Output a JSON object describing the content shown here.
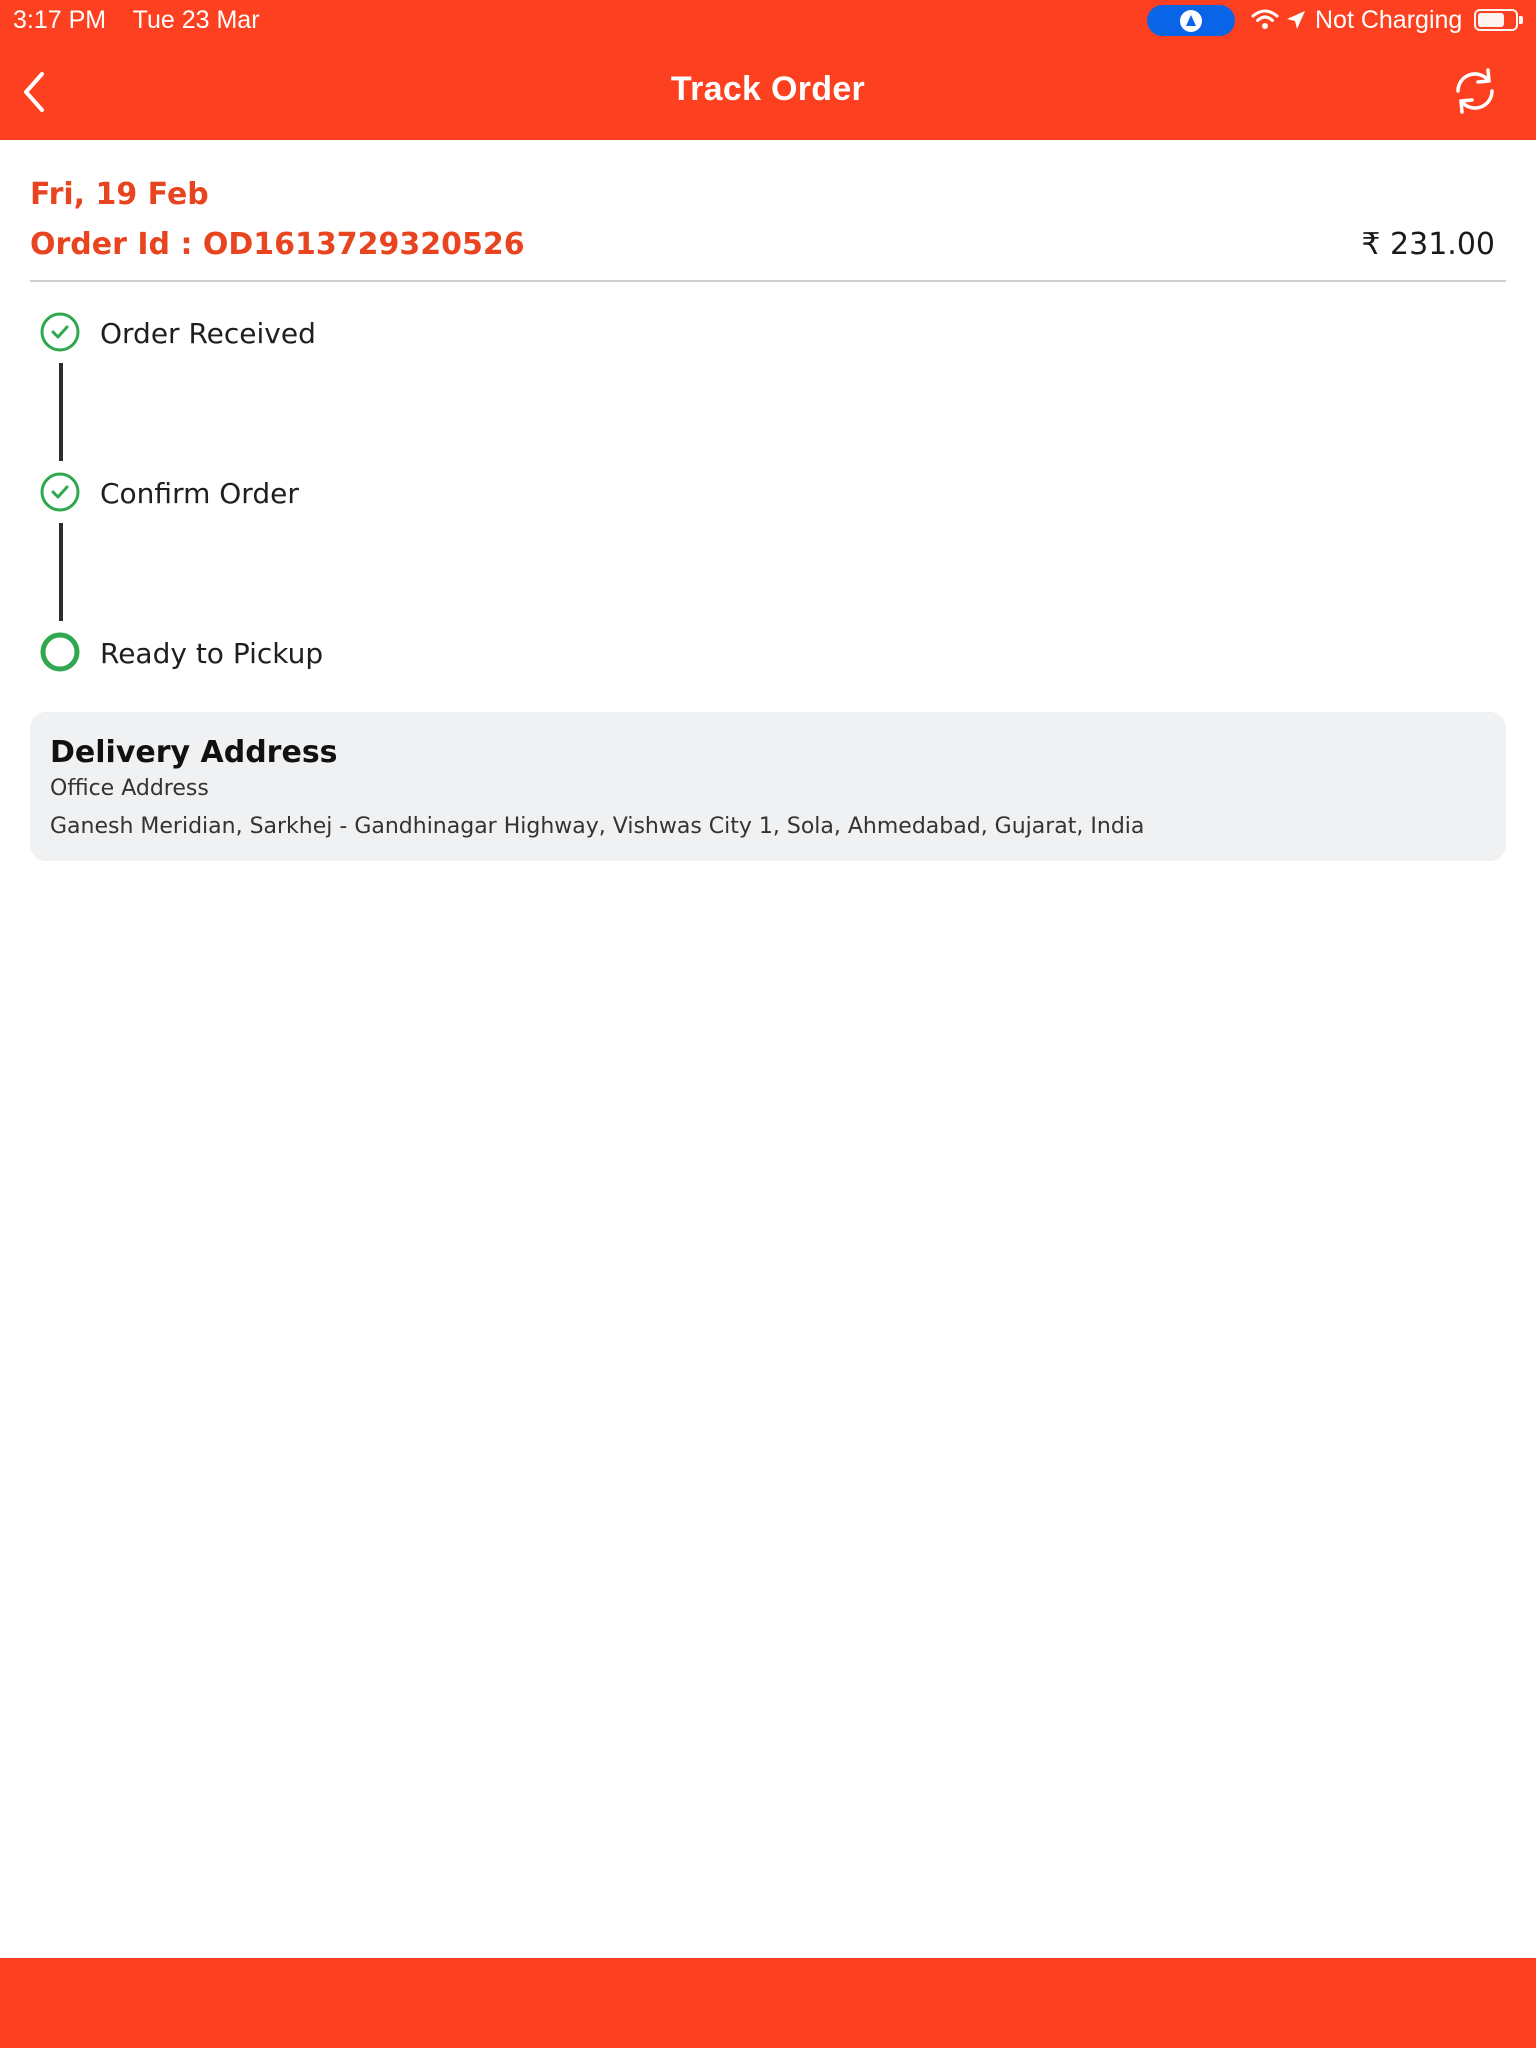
{
  "status_bar": {
    "time": "3:17 PM",
    "date": "Tue 23 Mar",
    "charging_text": "Not Charging"
  },
  "header": {
    "title": "Track Order",
    "back_icon": "chevron-left-icon",
    "refresh_icon": "refresh-icon"
  },
  "order": {
    "date": "Fri, 19 Feb",
    "id_label": "Order Id : OD1613729320526",
    "amount": "₹ 231.00"
  },
  "tracking_steps": [
    {
      "label": "Order Received",
      "status": "completed"
    },
    {
      "label": "Confirm Order",
      "status": "completed"
    },
    {
      "label": "Ready to Pickup",
      "status": "current"
    }
  ],
  "delivery_address": {
    "heading": "Delivery Address",
    "type": "Office Address",
    "address": "Ganesh Meridian, Sarkhej - Gandhinagar Highway, Vishwas City 1, Sola, Ahmedabad, Gujarat, India"
  },
  "colors": {
    "brand": "#fd401f",
    "accent_text": "#e84420",
    "success": "#2fa84f"
  }
}
